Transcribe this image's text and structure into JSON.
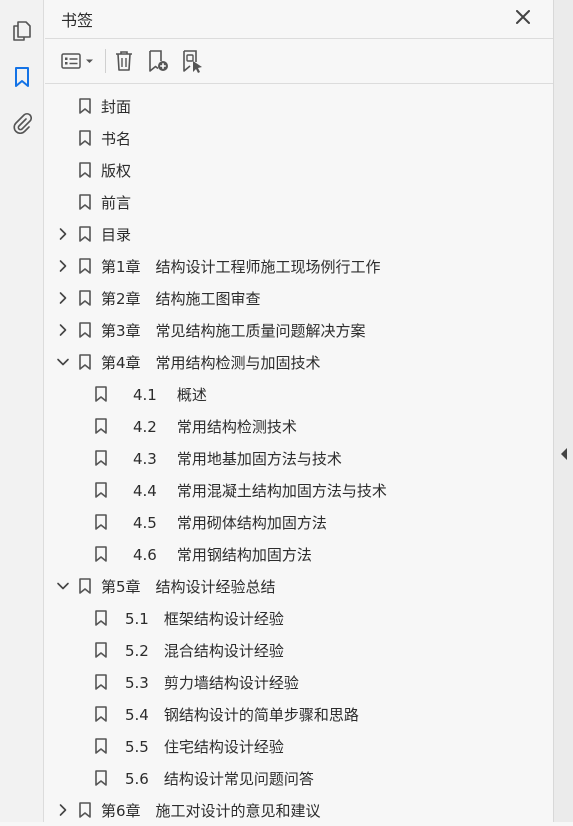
{
  "panel": {
    "title": "书签"
  },
  "colors": {
    "accent": "#1473e6",
    "icon": "#555555",
    "text": "#2c2c2c"
  },
  "left_toolbar": [
    "pages-icon",
    "bookmark-icon",
    "attachment-icon"
  ],
  "toolbar_icons": [
    "options-icon",
    "delete-icon",
    "add-bookmark-icon",
    "new-bookmark-from-structure-icon"
  ],
  "bookmarks": [
    {
      "level": 0,
      "num": "",
      "title": "封面",
      "expand": "none"
    },
    {
      "level": 0,
      "num": "",
      "title": "书名",
      "expand": "none"
    },
    {
      "level": 0,
      "num": "",
      "title": "版权",
      "expand": "none"
    },
    {
      "level": 0,
      "num": "",
      "title": "前言",
      "expand": "none"
    },
    {
      "level": 0,
      "num": "",
      "title": "目录",
      "expand": "collapsed"
    },
    {
      "level": 0,
      "num": "第1章",
      "title": "结构设计工程师施工现场例行工作",
      "expand": "collapsed"
    },
    {
      "level": 0,
      "num": "第2章",
      "title": "结构施工图审查",
      "expand": "collapsed"
    },
    {
      "level": 0,
      "num": "第3章",
      "title": "常见结构施工质量问题解决方案",
      "expand": "collapsed"
    },
    {
      "level": 0,
      "num": "第4章",
      "title": "常用结构检测与加固技术",
      "expand": "expanded"
    },
    {
      "level": 1,
      "num": "4.1",
      "title": "概述",
      "expand": "none"
    },
    {
      "level": 1,
      "num": "4.2",
      "title": "常用结构检测技术",
      "expand": "none"
    },
    {
      "level": 1,
      "num": "4.3",
      "title": "常用地基加固方法与技术",
      "expand": "none"
    },
    {
      "level": 1,
      "num": "4.4",
      "title": "常用混凝土结构加固方法与技术",
      "expand": "none"
    },
    {
      "level": 1,
      "num": "4.5",
      "title": "常用砌体结构加固方法",
      "expand": "none"
    },
    {
      "level": 1,
      "num": "4.6",
      "title": "常用钢结构加固方法",
      "expand": "none"
    },
    {
      "level": 0,
      "num": "第5章",
      "title": "结构设计经验总结",
      "expand": "expanded"
    },
    {
      "level": 1,
      "num": "5.1",
      "title": "框架结构设计经验",
      "expand": "none"
    },
    {
      "level": 1,
      "num": "5.2",
      "title": "混合结构设计经验",
      "expand": "none"
    },
    {
      "level": 1,
      "num": "5.3",
      "title": "剪力墙结构设计经验",
      "expand": "none"
    },
    {
      "level": 1,
      "num": "5.4",
      "title": "钢结构设计的简单步骤和思路",
      "expand": "none"
    },
    {
      "level": 1,
      "num": "5.5",
      "title": "住宅结构设计经验",
      "expand": "none"
    },
    {
      "level": 1,
      "num": "5.6",
      "title": "结构设计常见问题问答",
      "expand": "none"
    },
    {
      "level": 0,
      "num": "第6章",
      "title": "施工对设计的意见和建议",
      "expand": "collapsed"
    }
  ]
}
